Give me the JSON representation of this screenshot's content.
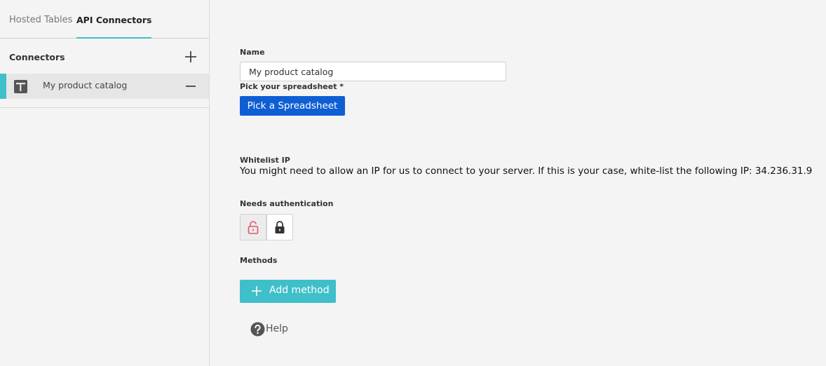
{
  "sidebar": {
    "tabs": [
      {
        "label": "Hosted Tables",
        "active": false
      },
      {
        "label": "API Connectors",
        "active": true
      }
    ],
    "section_title": "Connectors",
    "add_icon": "plus-icon",
    "items": [
      {
        "label": "My product catalog",
        "icon": "table-icon",
        "selected": true
      }
    ]
  },
  "form": {
    "name_label": "Name",
    "name_value": "My product catalog",
    "spreadsheet_label": "Pick your spreadsheet *",
    "pick_button": "Pick a Spreadsheet",
    "whitelist_label": "Whitelist IP",
    "whitelist_text": "You might need to allow an IP for us to connect to your server. If this is your case, white-list the following IP: 34.236.31.9",
    "auth_label": "Needs authentication",
    "auth_options": [
      {
        "icon": "unlock-icon",
        "selected": true
      },
      {
        "icon": "lock-icon",
        "selected": false
      }
    ],
    "methods_label": "Methods",
    "add_method_button": "Add method",
    "help_label": "Help"
  },
  "colors": {
    "accent": "#3fbfc9",
    "primary_button": "#0f5fd4",
    "unlock_icon": "#e0566b",
    "background": "#f4f4f4"
  }
}
